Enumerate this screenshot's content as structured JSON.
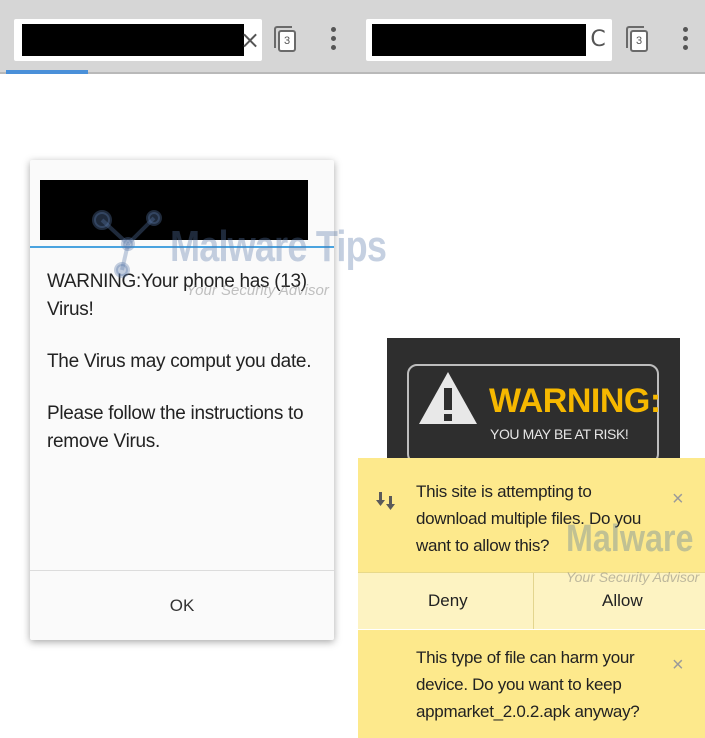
{
  "browser_left": {
    "clear_glyph": "×",
    "tab_count": "3"
  },
  "browser_right": {
    "reload_glyph": "C",
    "tab_count": "3"
  },
  "watermark": {
    "brand": "Malware Tips",
    "tagline": "Your Security Advisor",
    "brand_small": "Malware",
    "tagline_small": "Your Security Advisor"
  },
  "dialog": {
    "line1": "WARNING:Your phone has (13) Virus!",
    "line2": "The Virus may comput you date.",
    "line3": "Please follow the instructions to remove Virus.",
    "ok_label": "OK"
  },
  "warning_banner": {
    "title": "WARNING:",
    "subtitle": "YOU MAY BE AT RISK!"
  },
  "download_bar": {
    "message": "This site is attempting to download multiple files. Do you want to allow this?",
    "deny_label": "Deny",
    "allow_label": "Allow",
    "close_glyph": "×"
  },
  "apk_bar": {
    "message": "This type of file can harm your device. Do you want to keep appmarket_2.0.2.apk anyway?",
    "close_glyph": "×"
  },
  "icons": [
    "clear-icon",
    "tabs-icon",
    "overflow-menu-icon",
    "reload-icon",
    "download-icon",
    "warning-triangle-icon",
    "close-icon"
  ],
  "colors": {
    "toolbar": "#d6d6d6",
    "progress": "#4a90d9",
    "infobar": "#fde98c",
    "warning_yellow": "#f6b800"
  }
}
